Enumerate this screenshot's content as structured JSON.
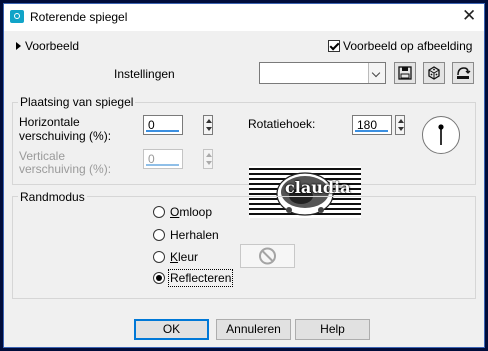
{
  "window": {
    "title": "Roterende spiegel"
  },
  "header": {
    "preview_label": "Voorbeeld",
    "preview_on_image_label": "Voorbeeld op afbeelding",
    "preview_on_image_checked": true
  },
  "settings": {
    "label": "Instellingen",
    "value": ""
  },
  "placement": {
    "group_title": "Plaatsing van spiegel",
    "h_label_1": "Horizontale",
    "h_label_2": "verschuiving (%):",
    "h_value": "0",
    "v_label_1": "Verticale",
    "v_label_2": "verschuiving (%):",
    "v_value": "0",
    "angle_label": "Rotatiehoek:",
    "angle_value": "180"
  },
  "preview_image": {
    "watermark_text": "claudia"
  },
  "edge_mode": {
    "group_title": "Randmodus",
    "options": [
      "Omloop",
      "Herhalen",
      "Kleur",
      "Reflecteren"
    ],
    "selected": "Reflecteren"
  },
  "buttons": {
    "ok": "OK",
    "cancel": "Annuleren",
    "help": "Help"
  }
}
